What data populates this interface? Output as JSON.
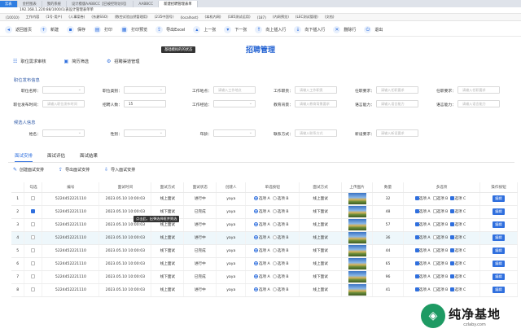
{
  "browser": {
    "tabs": [
      "云表",
      "金控图表",
      "我的系统",
      "设计模版AABBCC【已被控制访问】",
      "AABBCC",
      "新建招聘管理表单"
    ],
    "address": "192.168.1.220:88/1000/1/表设计管理表单单",
    "bookmarks": [
      "(10010)",
      "工作内容",
      "(1号-用户)",
      "(人事案卷)",
      "(东爵SSO)",
      "(数控试验自然管理用)",
      "(235中国号)",
      "(localhost)",
      "(本机内网)",
      "(185测试运用)",
      "(187)",
      "(内网预览)",
      "(LEC测试管理)",
      "(文档)"
    ]
  },
  "toolbar": [
    {
      "icon": "back-icon",
      "glyph": "◂",
      "label": "返回首页"
    },
    {
      "icon": "new-icon",
      "glyph": "+",
      "label": "新建"
    },
    {
      "icon": "save-icon",
      "glyph": "▪",
      "label": "保存"
    },
    {
      "icon": "print-icon",
      "glyph": "▤",
      "label": "打印"
    },
    {
      "icon": "print-preview-icon",
      "glyph": "▦",
      "label": "打印预览"
    },
    {
      "icon": "export-excel-icon",
      "glyph": "⇪",
      "label": "导出Excel"
    },
    {
      "icon": "previous-icon",
      "glyph": "▴",
      "label": "上一张"
    },
    {
      "icon": "next-icon",
      "glyph": "▾",
      "label": "下一张"
    },
    {
      "icon": "insert-above-icon",
      "glyph": "↑",
      "label": "向上插入行"
    },
    {
      "icon": "insert-below-icon",
      "glyph": "↓",
      "label": "向下插入行"
    },
    {
      "icon": "delete-row-icon",
      "glyph": "✕",
      "label": "删除行"
    },
    {
      "icon": "exit-icon",
      "glyph": "⏻",
      "label": "退出"
    }
  ],
  "toolbar_tooltip": "基础模拟的的状态",
  "page_title": "招聘管理",
  "subnav": [
    {
      "icon": "audit-icon",
      "glyph": "☷",
      "label": "职位需求审核"
    },
    {
      "icon": "resume-icon",
      "glyph": "▣",
      "label": "简历筛选"
    },
    {
      "icon": "channel-icon",
      "glyph": "⚙",
      "label": "招聘渠道管理"
    }
  ],
  "section1": {
    "title": "职位发布信息",
    "row1": [
      {
        "label": "职位名称：",
        "placeholder": "请选择职位名称"
      },
      {
        "label": "职位类别：",
        "placeholder": "请选择职位类别"
      },
      {
        "label": "工作地点：",
        "placeholder": "请输入工作地点"
      },
      {
        "label": "工作职责：",
        "placeholder": "请输入工作职责"
      },
      {
        "label": "任职要求：",
        "placeholder": "请输入任职要求"
      },
      {
        "label": "任职要求：",
        "placeholder": "请输入任职要求"
      }
    ],
    "row2": [
      {
        "label": "职位发布时间：",
        "placeholder": "请输入职位发布时间"
      },
      {
        "label": "招聘人数：",
        "value": "15"
      },
      {
        "label": "工作经验：",
        "placeholder": "请选择工作经验要求"
      },
      {
        "label": "教育背景：",
        "placeholder": "请输入教育背景要求"
      },
      {
        "label": "语言能力：",
        "placeholder": "请输入语言能力"
      },
      {
        "label": "语言能力：",
        "placeholder": "请输入语言能力"
      }
    ]
  },
  "section2": {
    "title": "候选人信息",
    "row1": [
      {
        "label": "姓名：",
        "placeholder": "请选择姓名"
      },
      {
        "label": "性别：",
        "placeholder": "请选择性别"
      },
      {
        "label": "年龄：",
        "placeholder": "请选择年龄"
      },
      {
        "label": "联系方式：",
        "placeholder": "请输入联系方式"
      },
      {
        "label": "新设要求：",
        "placeholder": "请输入新设要求"
      }
    ]
  },
  "tabs": [
    "面试安排",
    "面试评估",
    "面试结果"
  ],
  "actions": [
    {
      "icon": "create-icon",
      "glyph": "✎",
      "label": "创建面试安排"
    },
    {
      "icon": "export-icon",
      "glyph": "⇪",
      "label": "导出面试安排"
    },
    {
      "icon": "import-icon",
      "glyph": "⇩",
      "label": "导入面试安排"
    }
  ],
  "table": {
    "headers": [
      "",
      "勾选",
      "编号",
      "面试时间",
      "面试方式",
      "面试状态",
      "创建人",
      "单选按钮",
      "面试方式",
      "上传图片",
      "数量",
      "多选项",
      "操作按钮"
    ],
    "radio_opts": [
      "选项 A",
      "选项 B"
    ],
    "check_opts": [
      "选项 A",
      "选项 B",
      "选项 C"
    ],
    "edit_label": "编辑",
    "rows": [
      {
        "n": "1",
        "chk": false,
        "id": "5224452221110",
        "time": "2023.05.10 10:00:03",
        "mode": "线上面试",
        "status": "进行中",
        "creator": "yaya",
        "radio": "A",
        "mode2": "线上面试",
        "qty": "32",
        "cbs": [
          true,
          false,
          true
        ]
      },
      {
        "n": "2",
        "chk": true,
        "id": "5224452221110",
        "time": "2023.05.10 10:00:03",
        "mode": "线下面试",
        "status": "已完成",
        "creator": "yaya",
        "radio": "A",
        "mode2": "线下面试",
        "qty": "48",
        "cbs": [
          true,
          false,
          true
        ]
      },
      {
        "n": "3",
        "chk": false,
        "id": "5224452221110",
        "time": "2023.05.10 10:00:03",
        "mode": "线上面试",
        "status": "进行中",
        "creator": "yaya",
        "radio": "A",
        "mode2": "线上面试",
        "qty": "57",
        "cbs": [
          true,
          false,
          true
        ]
      },
      {
        "n": "4",
        "chk": false,
        "id": "5224452221110",
        "time": "2023.05.10 10:00:03",
        "mode": "线上面试",
        "status": "进行中",
        "creator": "yaya",
        "radio": "A",
        "mode2": "线上面试",
        "qty": "36",
        "cbs": [
          true,
          false,
          true
        ]
      },
      {
        "n": "5",
        "chk": false,
        "id": "5224452221110",
        "time": "2023.05.10 10:00:03",
        "mode": "线下面试",
        "status": "已完成",
        "creator": "yaya",
        "radio": "A",
        "mode2": "线下面试",
        "qty": "44",
        "cbs": [
          true,
          false,
          true
        ]
      },
      {
        "n": "6",
        "chk": false,
        "id": "5224452221110",
        "time": "2023.05.10 10:00:03",
        "mode": "线上面试",
        "status": "进行中",
        "creator": "yaya",
        "radio": "A",
        "mode2": "线上面试",
        "qty": "65",
        "cbs": [
          true,
          false,
          true
        ]
      },
      {
        "n": "7",
        "chk": false,
        "id": "5224452221110",
        "time": "2023.05.10 10:00:03",
        "mode": "线下面试",
        "status": "已完成",
        "creator": "yaya",
        "radio": "A",
        "mode2": "线下面试",
        "qty": "96",
        "cbs": [
          true,
          false,
          true
        ]
      },
      {
        "n": "8",
        "chk": false,
        "id": "5224452221110",
        "time": "2023.05.10 10:00:03",
        "mode": "线上面试",
        "status": "进行中",
        "creator": "yaya",
        "radio": "A",
        "mode2": "线上面试",
        "qty": "41",
        "cbs": [
          true,
          false,
          true
        ]
      }
    ]
  },
  "cell_tooltip": "点击此，出弹选择框并筛选",
  "watermark": {
    "text": "纯净基地",
    "url": "czlaby.com"
  }
}
